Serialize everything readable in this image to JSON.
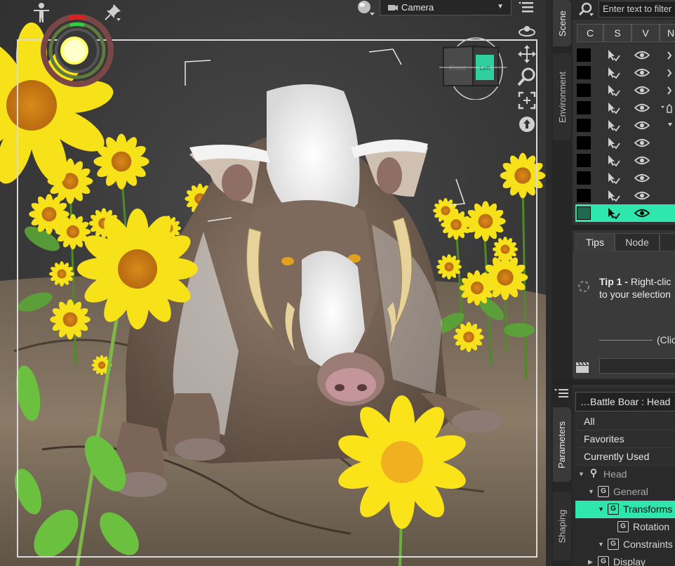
{
  "viewport": {
    "camera_label": "Camera",
    "nav_cube_faces": [
      "Front",
      "Left"
    ]
  },
  "side_tabs": [
    "Scene",
    "Environment",
    "Parameters",
    "Shaping"
  ],
  "scene": {
    "filter_placeholder": "Enter text to filter",
    "columns": [
      "C",
      "S",
      "V",
      "No"
    ],
    "rows": [
      {
        "extra": "chevron-right-icon"
      },
      {
        "extra": "chevron-right-icon"
      },
      {
        "extra": "chevron-right-icon"
      },
      {
        "extra": "bone-icon"
      },
      {
        "extra": "chevron-down-icon"
      },
      {
        "extra": ""
      },
      {
        "extra": ""
      },
      {
        "extra": ""
      },
      {
        "extra": ""
      },
      {
        "extra": "",
        "selected": true
      }
    ],
    "highlight_color": "#2fe7ad"
  },
  "tips": {
    "tabs": [
      "Tips",
      "Node"
    ],
    "tip_title": "Tip 1 -",
    "tip_line1": "Right-clic",
    "tip_line2": "to your selection",
    "click_text": "(Clic"
  },
  "parameters": {
    "node": "…Battle Boar : Head",
    "filters": [
      "All",
      "Favorites",
      "Currently Used"
    ],
    "tree": [
      {
        "label": "Head",
        "level": 0,
        "icon": "bone-icon",
        "dim": true
      },
      {
        "label": "General",
        "level": 1,
        "icon": "group-icon",
        "dim": true
      },
      {
        "label": "Transforms",
        "level": 2,
        "icon": "group-icon",
        "selected": true
      },
      {
        "label": "Rotation",
        "level": 3,
        "icon": "group-icon"
      },
      {
        "label": "Constraints",
        "level": 2,
        "icon": "group-icon"
      },
      {
        "label": "Display",
        "level": 1,
        "icon": "group-icon"
      }
    ]
  }
}
